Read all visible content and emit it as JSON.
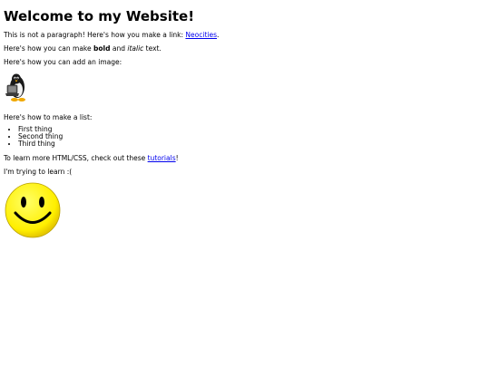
{
  "heading": "Welcome to my Website!",
  "intro": {
    "text": "This is not a paragraph! Here's how you make a link: ",
    "link_label": "Neocities",
    "after": "."
  },
  "formatting": {
    "before": "Here's how you can make ",
    "bold": "bold",
    "middle": " and ",
    "italic": "italic",
    "after": " text."
  },
  "image_intro": "Here's how you can add an image:",
  "list_intro": "Here's how to make a list:",
  "list_items": [
    "First thing",
    "Second thing",
    "Third thing"
  ],
  "learn_more": {
    "before": "To learn more HTML/CSS, check out these ",
    "link_label": "tutorials",
    "after": "!"
  },
  "status": "I'm trying to learn :(",
  "images": {
    "penguin": "penguin-computer-icon",
    "smiley": "smiley-face-icon"
  },
  "colors": {
    "link": "#0000ee",
    "smiley_fill": "#ffff00"
  }
}
